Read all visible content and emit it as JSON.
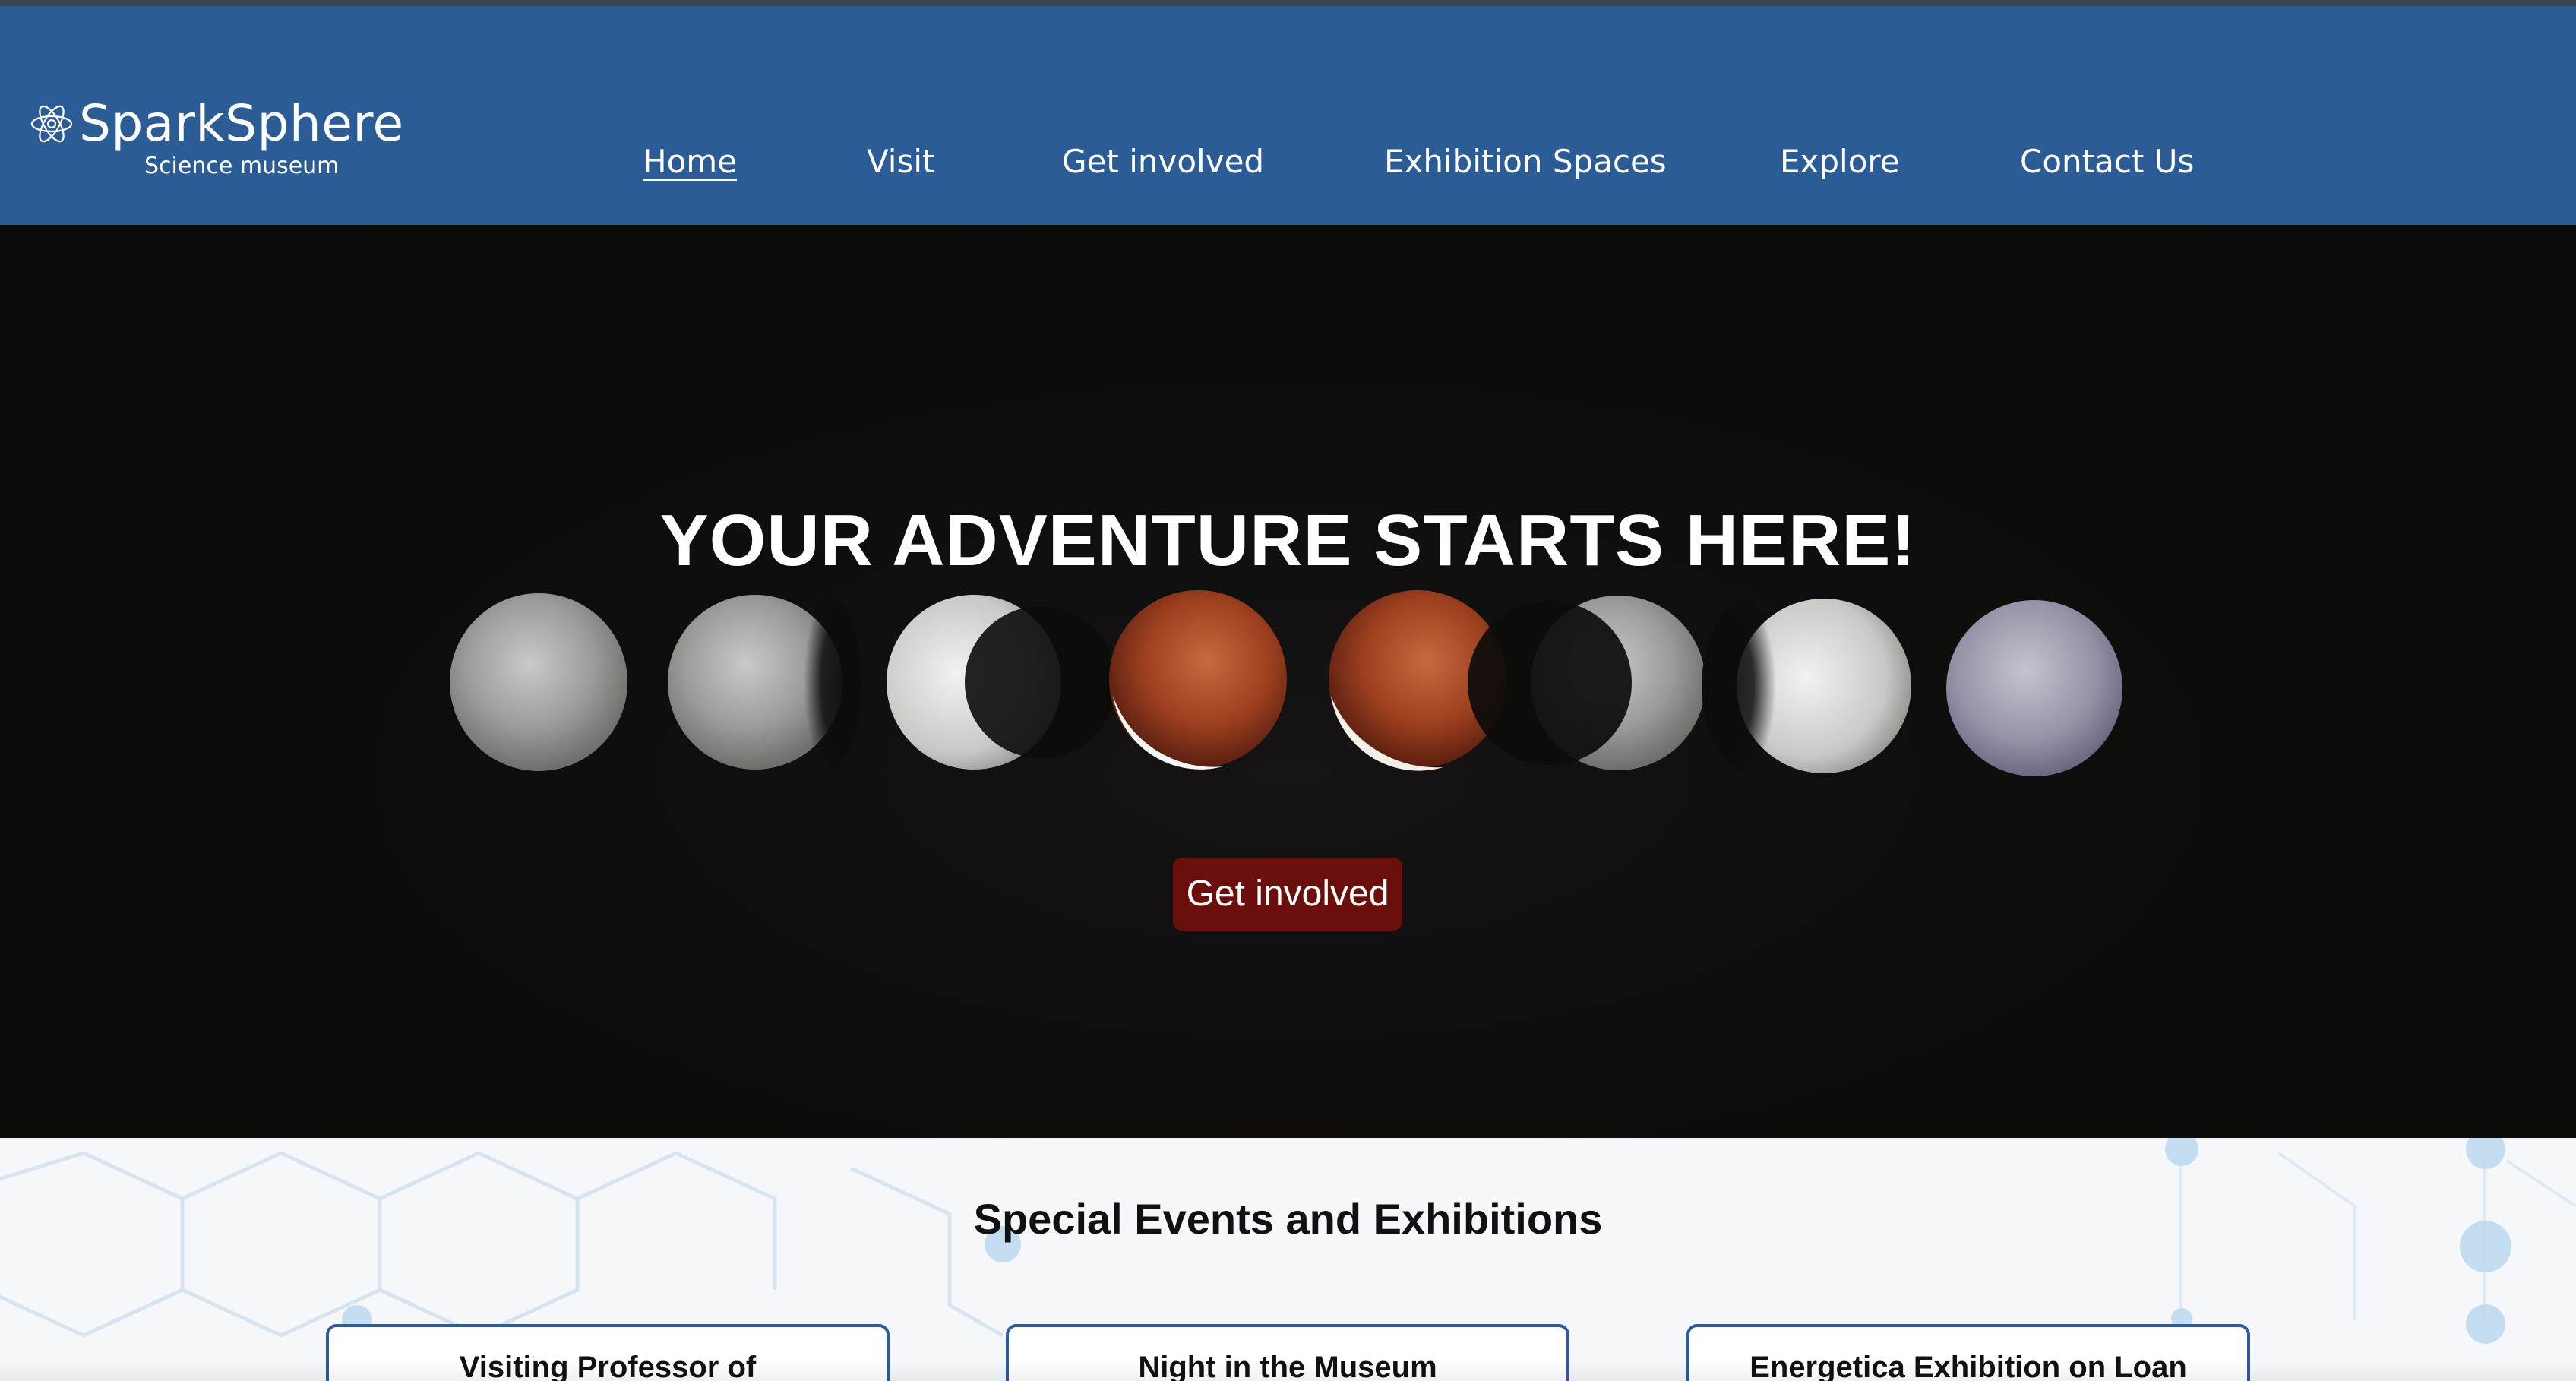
{
  "brand": {
    "name": "SparkSphere",
    "tagline": "Science museum",
    "logo_icon": "atom-icon"
  },
  "nav": {
    "items": [
      {
        "label": "Home",
        "active": true
      },
      {
        "label": "Visit"
      },
      {
        "label": "Get involved"
      },
      {
        "label": "Exhibition Spaces"
      },
      {
        "label": "Explore"
      },
      {
        "label": "Contact Us"
      }
    ]
  },
  "hero": {
    "title": "YOUR ADVENTURE STARTS HERE!",
    "cta_label": "Get involved",
    "image": "lunar-eclipse-phases"
  },
  "events": {
    "title": "Special Events and Exhibitions",
    "cards": [
      {
        "title": "Visiting Professor of"
      },
      {
        "title": "Night in the Museum"
      },
      {
        "title": "Energetica Exhibition on Loan"
      }
    ]
  },
  "colors": {
    "header_bg": "#2b5c96",
    "hero_bg": "#0c0c0b",
    "cta_bg": "#6b0f0c",
    "card_border": "#2d5aa0"
  }
}
